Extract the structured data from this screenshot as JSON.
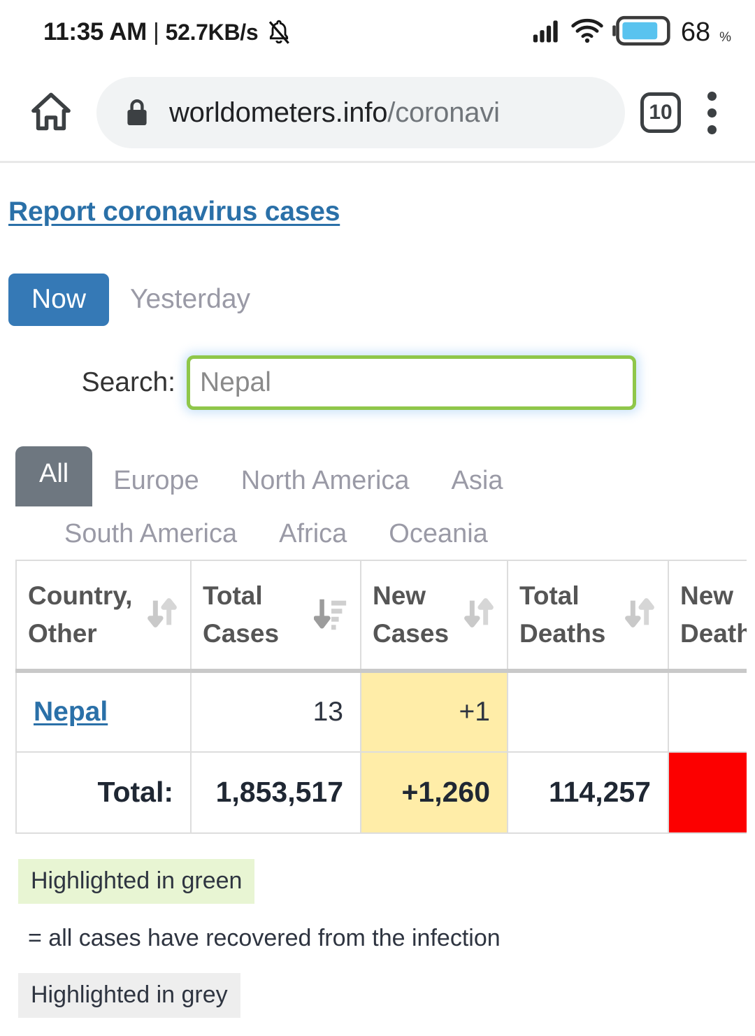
{
  "status_bar": {
    "time": "11:35 AM",
    "separator": "|",
    "network_speed": "52.7KB/s",
    "bell_icon": "bell-muted-icon",
    "signal_icon": "cellular-signal-icon",
    "wifi_icon": "wifi-icon",
    "battery_icon": "battery-icon",
    "battery_level": "68",
    "battery_unit": "%"
  },
  "browser": {
    "home_icon": "home-icon",
    "lock_icon": "lock-icon",
    "url_main": "worldometers.info",
    "url_path": "/coronavi",
    "tab_count": "10",
    "menu_icon": "overflow-menu-icon"
  },
  "page": {
    "report_link": "Report coronavirus cases",
    "toggle": {
      "now": "Now",
      "yesterday": "Yesterday"
    },
    "search": {
      "label": "Search:",
      "value": "Nepal",
      "placeholder": "Nepal"
    },
    "regions": [
      "All",
      "Europe",
      "North America",
      "Asia",
      "South America",
      "Africa",
      "Oceania"
    ],
    "active_region": "All"
  },
  "table": {
    "columns": [
      {
        "line1": "Country,",
        "line2": "Other",
        "sort": "both",
        "sort_icon": "sort-both-icon"
      },
      {
        "line1": "Total",
        "line2": "Cases",
        "sort": "desc",
        "sort_icon": "sort-descending-icon"
      },
      {
        "line1": "New",
        "line2": "Cases",
        "sort": "both",
        "sort_icon": "sort-both-icon"
      },
      {
        "line1": "Total",
        "line2": "Deaths",
        "sort": "both",
        "sort_icon": "sort-both-icon"
      },
      {
        "line1": "New",
        "line2": "Deaths",
        "sort": "none",
        "sort_icon": "sort-both-icon"
      }
    ],
    "rows": [
      {
        "country": "Nepal",
        "total_cases": "13",
        "new_cases": "+1",
        "total_deaths": "",
        "new_deaths": ""
      }
    ],
    "total_row": {
      "label": "Total:",
      "total_cases": "1,853,517",
      "new_cases": "+1,260",
      "total_deaths": "114,257",
      "new_deaths": ""
    }
  },
  "legend": {
    "green_chip": "Highlighted in green",
    "green_text": "= all cases have recovered from the infection",
    "grey_chip": "Highlighted in grey"
  },
  "colors": {
    "accent_blue": "#3579b6",
    "link_blue": "#2a70a8",
    "active_tab_grey": "#6e7780",
    "highlight_yellow": "#ffeda8",
    "highlight_red": "#fc0000",
    "legend_green": "#e8f5d3",
    "legend_grey": "#eeeeee",
    "search_border_green": "#8fc74a"
  }
}
